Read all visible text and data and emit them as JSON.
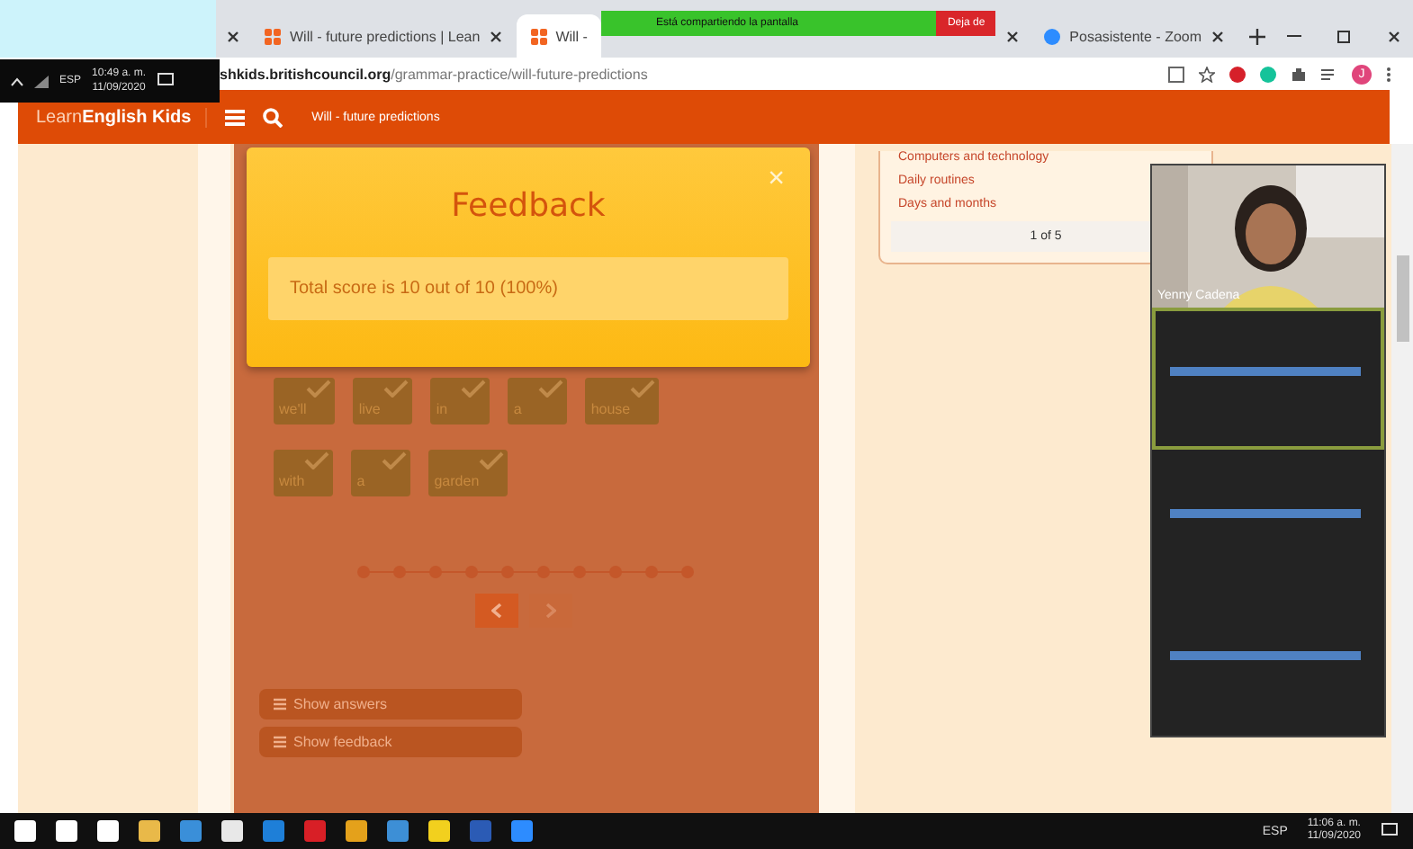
{
  "tray_popup": {
    "language": "ESP",
    "time": "10:49 a. m.",
    "date": "11/09/2020"
  },
  "browser": {
    "tabs": [
      {
        "title": "Will - future predictions | Lean",
        "selected": false
      },
      {
        "title": "Will -",
        "selected": true
      },
      {
        "title": "Posasistente - Zoom",
        "selected": false
      }
    ],
    "sharing_bar": {
      "text": "Está compartiendo la pantalla",
      "stop": "Deja de"
    },
    "address": {
      "host": "shkids.britishcouncil.org",
      "path": "/grammar-practice/will-future-predictions"
    },
    "profile": "J"
  },
  "site_header": {
    "logo": "Learn**English Kids**",
    "page_title": "Will - future predictions"
  },
  "feedback": {
    "title": "Feedback",
    "close": "×",
    "message": "Total score is 10 out of 10 (100%)"
  },
  "word_rows": [
    [
      {
        "text": "we'll",
        "checked": true
      },
      {
        "text": "live",
        "checked": true
      },
      {
        "text": "in",
        "checked": true
      },
      {
        "text": "a",
        "checked": true
      },
      {
        "text": "house",
        "checked": true
      }
    ],
    [
      {
        "text": "with",
        "checked": true
      },
      {
        "text": "a",
        "checked": true
      },
      {
        "text": "garden",
        "checked": true
      }
    ]
  ],
  "pager_nav": {
    "prev_disabled": false,
    "next_disabled": true
  },
  "actions": [
    "Show answers",
    "Show feedback"
  ],
  "topics": [
    "Computers and technology",
    "Daily routines",
    "Days and months"
  ],
  "topics_pager": "1 of 5",
  "zoom_participants": [
    {
      "kind": "video",
      "name": "Yenny Cadena",
      "active": false
    },
    {
      "kind": "redacted",
      "active": true
    },
    {
      "kind": "redacted",
      "active": false
    },
    {
      "kind": "redacted",
      "active": false
    }
  ],
  "taskbar": {
    "language": "ESP",
    "time": "11:06 a. m.",
    "date": "11/09/2020"
  }
}
